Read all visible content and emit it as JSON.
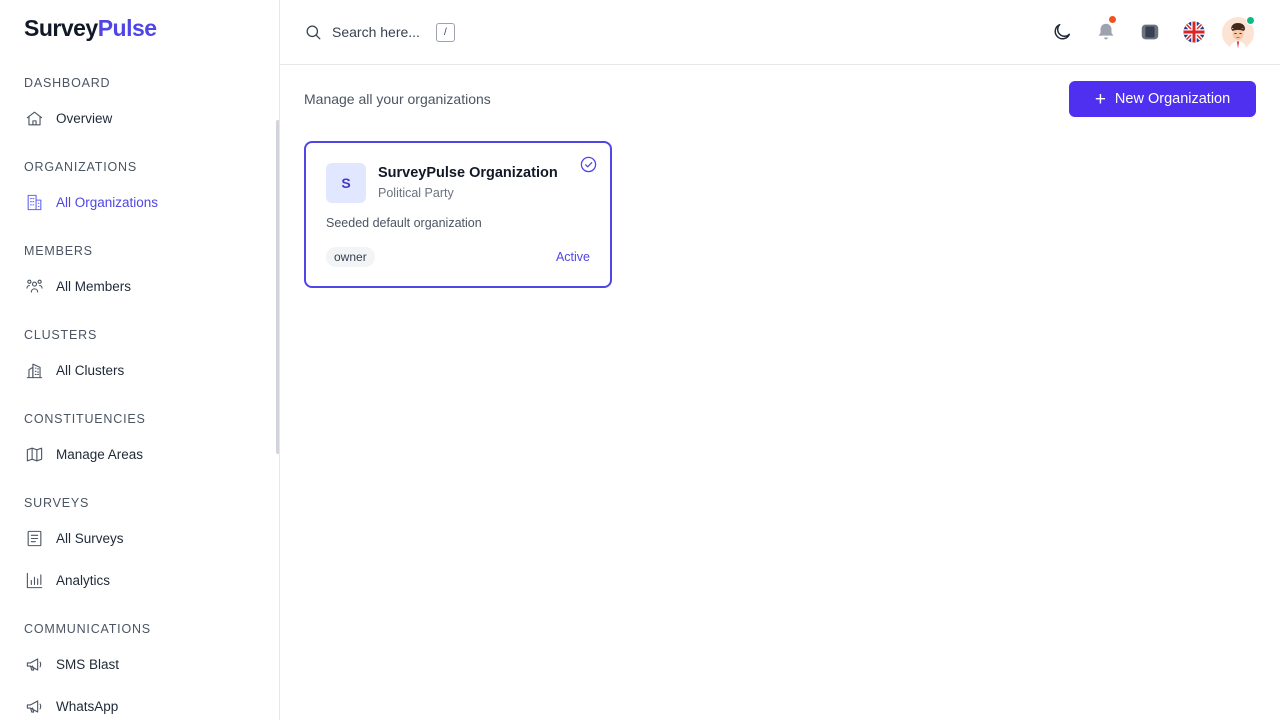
{
  "brand": {
    "part1": "Survey",
    "part2": "Pulse"
  },
  "sidebar": {
    "sections": [
      {
        "label": "DASHBOARD",
        "items": [
          {
            "label": "Overview",
            "icon": "home-icon"
          }
        ]
      },
      {
        "label": "ORGANIZATIONS",
        "items": [
          {
            "label": "All Organizations",
            "icon": "building-icon",
            "active": true
          }
        ]
      },
      {
        "label": "MEMBERS",
        "items": [
          {
            "label": "All Members",
            "icon": "users-icon"
          }
        ]
      },
      {
        "label": "CLUSTERS",
        "items": [
          {
            "label": "All Clusters",
            "icon": "buildings-icon"
          }
        ]
      },
      {
        "label": "CONSTITUENCIES",
        "items": [
          {
            "label": "Manage Areas",
            "icon": "map-icon"
          }
        ]
      },
      {
        "label": "SURVEYS",
        "items": [
          {
            "label": "All Surveys",
            "icon": "document-icon"
          },
          {
            "label": "Analytics",
            "icon": "bar-chart-icon"
          }
        ]
      },
      {
        "label": "COMMUNICATIONS",
        "items": [
          {
            "label": "SMS Blast",
            "icon": "megaphone-icon"
          },
          {
            "label": "WhatsApp",
            "icon": "megaphone-icon"
          }
        ]
      }
    ]
  },
  "header": {
    "search_placeholder": "Search here...",
    "search_shortcut": "/",
    "icons": [
      "moon-icon",
      "bell-icon",
      "apps-icon",
      "uk-flag-icon",
      "user-avatar"
    ],
    "notification_dot_color": "#f4511e",
    "online_dot_color": "#10b981"
  },
  "main": {
    "subtitle": "Manage all your organizations",
    "new_button_label": "New Organization",
    "accent_color": "#4f2ff0",
    "organizations": [
      {
        "initial": "S",
        "name": "SurveyPulse Organization",
        "type": "Political Party",
        "description": "Seeded default organization",
        "role": "owner",
        "status": "Active",
        "selected": true
      }
    ]
  }
}
